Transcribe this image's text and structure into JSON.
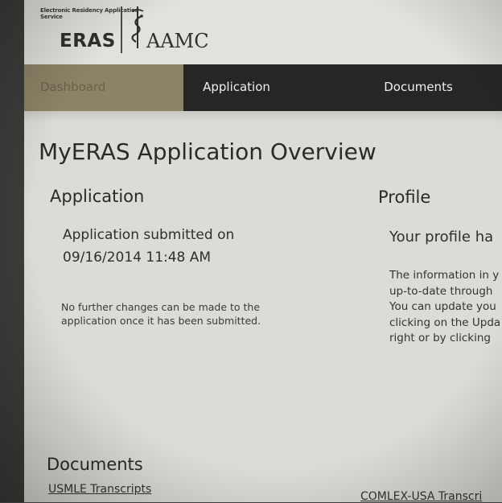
{
  "header": {
    "tagline": "Electronic Residency Application Service",
    "eras_logo": "ERAS",
    "aamc_logo": "AAMC",
    "caduceus_icon": "caduceus-icon"
  },
  "nav": {
    "tabs": [
      {
        "label": "Dashboard",
        "active": true
      },
      {
        "label": "Application",
        "active": false
      },
      {
        "label": "Documents",
        "active": false
      }
    ],
    "colors": {
      "bar": "#262626",
      "active_tab": "#8b8366"
    }
  },
  "main": {
    "title": "MyERAS Application Overview",
    "application": {
      "heading": "Application",
      "status_line1": "Application submitted on",
      "status_line2": "09/16/2014 11:48 AM",
      "note": "No further changes can be made to the application once it has been submitted."
    },
    "profile": {
      "heading": "Profile",
      "subheading": "Your profile ha",
      "text_lines": [
        "The information in y",
        "up-to-date through",
        "You can update you",
        "clicking on the Upda",
        "right or by clicking"
      ]
    },
    "documents": {
      "heading": "Documents",
      "links": [
        "USMLE Transcripts",
        "COMLEX-USA Transcri"
      ]
    }
  }
}
